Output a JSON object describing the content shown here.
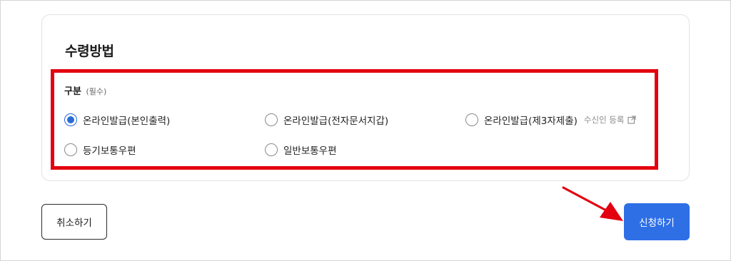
{
  "section": {
    "title": "수령방법",
    "label": "구분",
    "required_note": "(필수)"
  },
  "options": [
    {
      "label": "온라인발급(본인출력)",
      "checked": true
    },
    {
      "label": "온라인발급(전자문서지갑)",
      "checked": false
    },
    {
      "label": "온라인발급(제3자제출)",
      "checked": false,
      "subnote": "수신인 등록",
      "subnote_icon": "external-link-icon"
    },
    {
      "label": "등기보통우편",
      "checked": false
    },
    {
      "label": "일반보통우편",
      "checked": false
    }
  ],
  "buttons": {
    "cancel": "취소하기",
    "apply": "신청하기"
  },
  "colors": {
    "accent": "#2e6fe6",
    "highlight": "#e3000f",
    "radio_checked": "#2a6ad8"
  }
}
